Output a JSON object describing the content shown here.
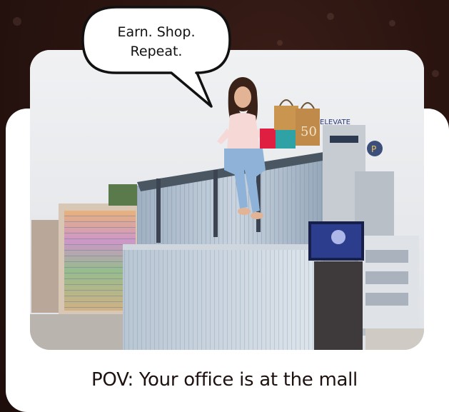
{
  "speech_bubble": {
    "line1": "Earn. Shop.",
    "line2": "Repeat."
  },
  "photo": {
    "sign_text": "ELEVATE",
    "bag_label": "50"
  },
  "caption": "POV: Your office is at the mall",
  "colors": {
    "background": "#2a1410",
    "card": "#ffffff",
    "caption_text": "#1e1210"
  }
}
